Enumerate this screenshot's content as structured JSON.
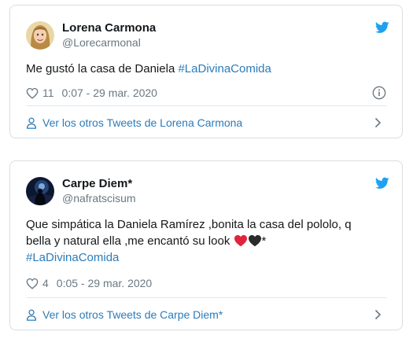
{
  "colors": {
    "accent": "#2b7bb9",
    "twitter_blue": "#1da1f2",
    "text": "#14171a",
    "muted": "#697882",
    "border": "#d9dde1"
  },
  "tweets": [
    {
      "author": "Lorena Carmona",
      "handle": "@Lorecarmonal",
      "text_before": "Me gustó la casa de Daniela ",
      "hashtag": "#LaDivinaComida",
      "likes": "11",
      "timestamp": "0:07 - 29 mar. 2020",
      "footer_label": "Ver los otros Tweets de Lorena Carmona",
      "icons": [
        "twitter-bird-icon",
        "heart-icon",
        "info-icon",
        "person-icon",
        "chevron-right-icon"
      ]
    },
    {
      "author": "Carpe Diem*",
      "handle": "@nafratscisum",
      "text_line1": "Que simpática la Daniela Ramírez ,bonita la casa del pololo, q",
      "text_line2": "bella y natural ella ,me encantó su look ",
      "text_after_emoji": "*",
      "hashtag": "#LaDivinaComida",
      "likes": "4",
      "timestamp": "0:05 - 29 mar. 2020",
      "footer_label": "Ver los otros Tweets de Carpe Diem*",
      "icons": [
        "twitter-bird-icon",
        "heart-icon",
        "person-icon",
        "chevron-right-icon"
      ]
    }
  ]
}
